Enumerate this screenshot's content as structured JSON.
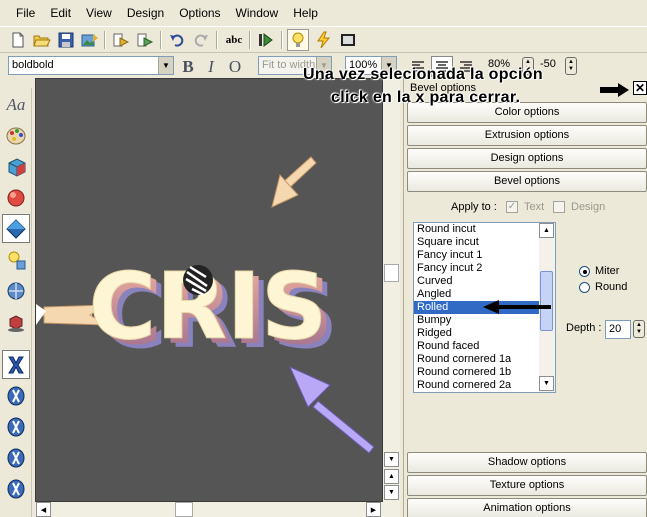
{
  "menu": [
    "File",
    "Edit",
    "View",
    "Design",
    "Options",
    "Window",
    "Help"
  ],
  "toolbar": {
    "font_name": "boldbold",
    "fit_mode": "Fit to width",
    "zoom": "100%",
    "scale": "80%",
    "spacing": "-50",
    "bold_glyph": "B",
    "italic_glyph": "I",
    "outline_glyph": "O",
    "spell_glyph": "abc"
  },
  "overlay": {
    "line1": "Una vez selecionada la opción",
    "line2": "click en la x para cerrar."
  },
  "canvas": {
    "text": "CRIS",
    "background": "#555555",
    "text_color": "#fdf5d3",
    "bevel_color": "#c87a78",
    "shadow_color": "#9087c8"
  },
  "panel": {
    "title": "Bevel options",
    "sections_top": [
      "Color options",
      "Extrusion options",
      "Design options",
      "Bevel options"
    ],
    "apply_to_label": "Apply to :",
    "apply_text_label": "Text",
    "apply_design_label": "Design",
    "apply_text_checked": true,
    "apply_design_checked": false,
    "bevel_types": [
      "Round incut",
      "Square incut",
      "Fancy incut 1",
      "Fancy incut 2",
      "Curved",
      "Angled",
      "Rolled",
      "Bumpy",
      "Ridged",
      "Round faced",
      "Round cornered 1a",
      "Round cornered 1b",
      "Round cornered 2a"
    ],
    "selected_bevel": "Rolled",
    "corner_options": [
      "Miter",
      "Round"
    ],
    "selected_corner": "Miter",
    "depth_label": "Depth :",
    "depth_value": "20",
    "sections_bottom": [
      "Shadow options",
      "Texture options",
      "Animation options"
    ]
  },
  "colors": {
    "selection": "#316ac5",
    "chrome": "#ece9d8",
    "arrow_peach": "#f6d8b0",
    "arrow_lilac": "#b9a8f5"
  }
}
